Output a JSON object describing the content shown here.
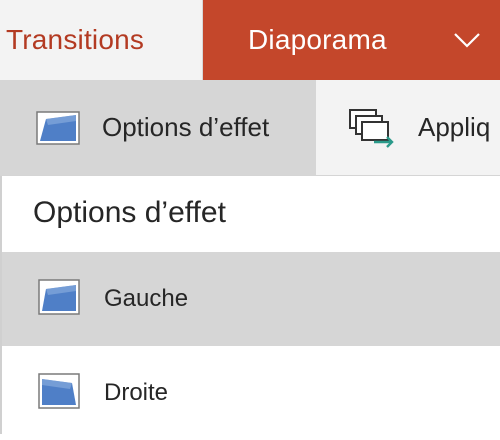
{
  "tabs": {
    "transitions": "Transitions",
    "diaporama": "Diaporama",
    "more_icon": "chevron-down-icon"
  },
  "toolbar": {
    "effect_options_label": "Options d’effet",
    "apply_label": "Appliq"
  },
  "panel": {
    "title": "Options d’effet",
    "options": [
      {
        "label": "Gauche",
        "selected": true,
        "icon": "effect-left-icon"
      },
      {
        "label": "Droite",
        "selected": false,
        "icon": "effect-right-icon"
      }
    ]
  },
  "colors": {
    "ribbon": "#c4472b",
    "active_tab_text": "#b33a22",
    "selected_bg": "#d6d6d6",
    "icon_blue": "#4f7fc7"
  }
}
